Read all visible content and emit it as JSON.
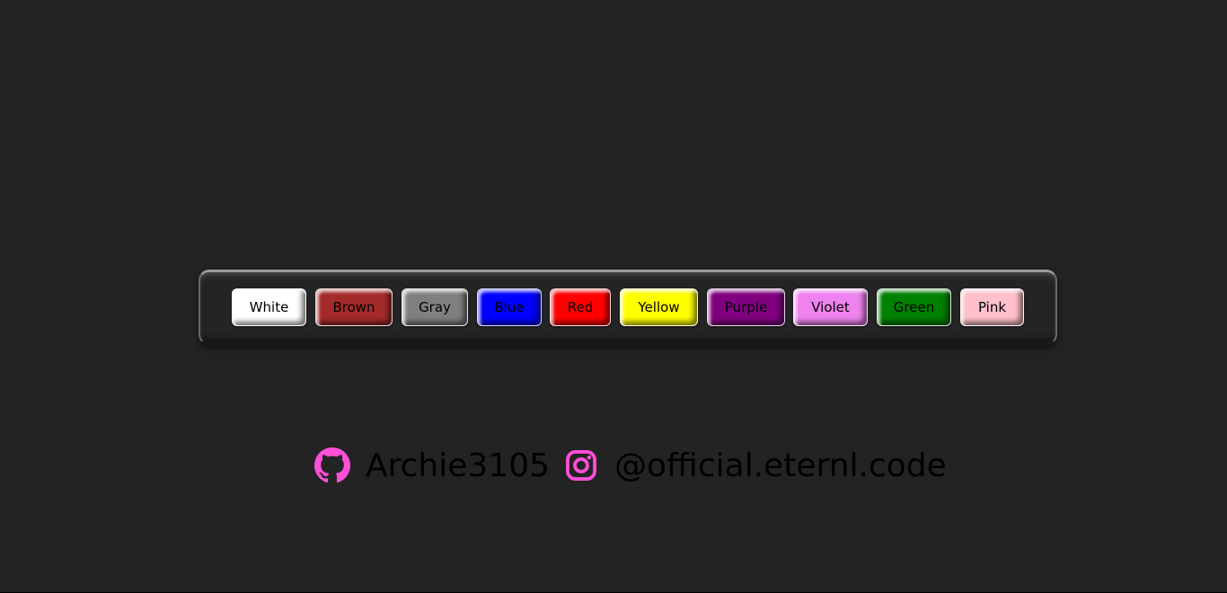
{
  "buttons": [
    {
      "label": "White",
      "color": "#ffffff"
    },
    {
      "label": "Brown",
      "color": "#a52a2a"
    },
    {
      "label": "Gray",
      "color": "#808080"
    },
    {
      "label": "Blue",
      "color": "#0000ff"
    },
    {
      "label": "Red",
      "color": "#ff0000"
    },
    {
      "label": "Yellow",
      "color": "#ffff00"
    },
    {
      "label": "Purple",
      "color": "#800080"
    },
    {
      "label": "Violet",
      "color": "#ee82ee"
    },
    {
      "label": "Green",
      "color": "#008000"
    },
    {
      "label": "Pink",
      "color": "#ffc0cb"
    }
  ],
  "footer": {
    "github_icon": "github-icon",
    "github_handle": "Archie3105",
    "instagram_icon": "instagram-icon",
    "instagram_handle": "@official.eternl.code",
    "icon_color": "#ff4fd8"
  },
  "colors": {
    "background": "#232323",
    "panel": "#242424"
  }
}
